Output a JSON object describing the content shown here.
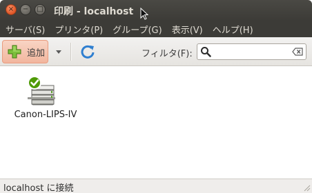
{
  "window": {
    "title": "印刷 - localhost",
    "close_glyph": "×",
    "minimize_glyph": "−",
    "maximize_glyph": "□"
  },
  "menubar": {
    "items": [
      {
        "label": "サーバ(S)"
      },
      {
        "label": "プリンタ(P)"
      },
      {
        "label": "グループ(G)"
      },
      {
        "label": "表示(V)"
      },
      {
        "label": "ヘルプ(H)"
      }
    ]
  },
  "toolbar": {
    "add_label": "追加",
    "add_icon": "plus-icon",
    "dropdown_icon": "chevron-down-icon",
    "refresh_icon": "refresh-icon",
    "filter_label": "フィルタ(F):",
    "search_value": "",
    "search_icon": "search-icon",
    "clear_icon": "clear-icon"
  },
  "printers": [
    {
      "name": "Canon-LIPS-IV",
      "icon": "printer-icon",
      "status_icon": "checkmark-icon"
    }
  ],
  "statusbar": {
    "text": "localhost に接続"
  },
  "colors": {
    "titlebar": "#3c3b37",
    "add_button_bg": "#f2b69e",
    "add_button_border": "#e99b7e",
    "plus_green": "#6fb32e",
    "refresh_blue": "#2f7fd0",
    "check_green": "#4e9a06"
  }
}
